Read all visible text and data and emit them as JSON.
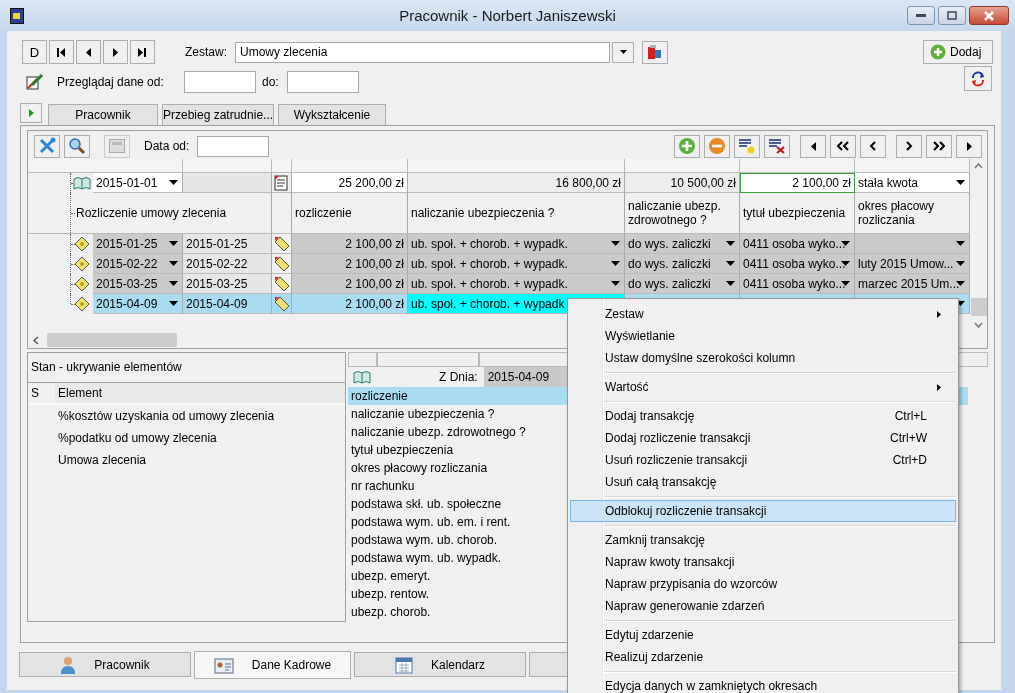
{
  "window": {
    "title": "Pracownik - Norbert Janiszewski"
  },
  "nav_first_label": "D",
  "zestaw": {
    "label": "Zestaw:",
    "value": "Umowy zlecenia"
  },
  "add_button": "Dodaj",
  "browse": {
    "label": "Przeglądaj dane od:",
    "to_label": "do:"
  },
  "tabs": [
    {
      "label": "Pracownik",
      "selected": false
    },
    {
      "label": "Przebieg zatrudnie...",
      "selected": false
    },
    {
      "label": "Wykształcenie",
      "selected": false
    }
  ],
  "grid": {
    "date_label": "Data od:",
    "summary": {
      "date": "2015-01-01",
      "amount": "25 200,00 zł",
      "amount_2": "16 800,00 zł",
      "amount_3": "10 500,00 zł",
      "amount_4": "2 100,00 zł",
      "mode": "stała kwota"
    },
    "group_label": "Rozliczenie umowy zlecenia",
    "columns": [
      "rozliczenie",
      "naliczanie ubezpieczenia ?",
      "naliczanie ubezp. zdrowotnego ?",
      "tytuł ubezpieczenia",
      "okres płacowy rozliczania"
    ],
    "rows": [
      {
        "date": "2015-01-25",
        "date_2": "2015-01-25",
        "amount": "2 100,00 zł",
        "insurance": "ub. społ. + chorob. + wypadk.",
        "health": "do wys. zaliczki",
        "title": "0411 osoba wyko...",
        "selected": false
      },
      {
        "date": "2015-02-22",
        "date_2": "2015-02-22",
        "amount": "2 100,00 zł",
        "insurance": "ub. społ. + chorob. + wypadk.",
        "health": "do wys. zaliczki",
        "title": "0411 osoba wyko...",
        "period": "luty 2015 Umow...",
        "selected": false
      },
      {
        "date": "2015-03-25",
        "date_2": "2015-03-25",
        "amount": "2 100,00 zł",
        "insurance": "ub. społ. + chorob. + wypadk.",
        "health": "do wys. zaliczki",
        "title": "0411 osoba wyko...",
        "period": "marzec 2015 Um...",
        "selected": false
      },
      {
        "date": "2015-04-09",
        "date_2": "2015-04-09",
        "amount": "2 100,00 zł",
        "insurance": "ub. społ. + chorob. + wypadk",
        "selected": true
      }
    ]
  },
  "visibility_panel": {
    "title": "Stan - ukrywanie elementów",
    "columns": [
      "S",
      "Element"
    ],
    "items": [
      "%kosztów uzyskania od umowy zlecenia",
      "%podatku od umowy zlecenia",
      "Umowa zlecenia"
    ]
  },
  "details_panel": {
    "date_label": "Z Dnia:",
    "date": "2015-04-09",
    "items": [
      {
        "label": "rozliczenie",
        "selected": true
      },
      {
        "label": "naliczanie ubezpieczenia ?",
        "selected": false
      },
      {
        "label": "naliczanie ubezp. zdrowotnego ?",
        "selected": false
      },
      {
        "label": "tytuł ubezpieczenia",
        "selected": false
      },
      {
        "label": "okres płacowy rozliczania",
        "selected": false
      },
      {
        "label": "nr rachunku",
        "selected": false
      },
      {
        "label": "podstawa skł. ub. społeczne",
        "selected": false
      },
      {
        "label": "podstawa wym. ub. em. i rent.",
        "selected": false
      },
      {
        "label": "podstawa wym. ub. chorob.",
        "selected": false
      },
      {
        "label": "podstawa wym. ub. wypadk.",
        "selected": false
      },
      {
        "label": "ubezp. emeryt.",
        "selected": false
      },
      {
        "label": "ubezp. rentow.",
        "selected": false
      },
      {
        "label": "ubezp. chorob.",
        "selected": false
      }
    ]
  },
  "bottom_tabs": [
    {
      "label": "Pracownik",
      "kind": "person",
      "selected": false
    },
    {
      "label": "Dane Kadrowe",
      "kind": "card",
      "selected": true
    },
    {
      "label": "Kalendarz",
      "kind": "calendar",
      "selected": false
    }
  ],
  "context_menu": [
    {
      "kind": "item",
      "label": "Zestaw",
      "submenu": true,
      "selected": false
    },
    {
      "kind": "item",
      "label": "Wyświetlanie",
      "selected": false
    },
    {
      "kind": "item",
      "label": "Ustaw domyślne szerokości kolumn",
      "selected": false
    },
    {
      "kind": "separator"
    },
    {
      "kind": "item",
      "label": "Wartość",
      "submenu": true,
      "selected": false
    },
    {
      "kind": "separator"
    },
    {
      "kind": "item",
      "label": "Dodaj transakcję",
      "shortcut": "Ctrl+L",
      "selected": false
    },
    {
      "kind": "item",
      "label": "Dodaj rozliczenie transakcji",
      "shortcut": "Ctrl+W",
      "selected": false
    },
    {
      "kind": "item",
      "label": "Usuń rozliczenie transakcji",
      "shortcut": "Ctrl+D",
      "selected": false
    },
    {
      "kind": "item",
      "label": "Usuń całą transakcję",
      "selected": false
    },
    {
      "kind": "separator"
    },
    {
      "kind": "item",
      "label": "Odblokuj rozliczenie transakcji",
      "selected": true
    },
    {
      "kind": "separator"
    },
    {
      "kind": "item",
      "label": "Zamknij transakcję",
      "selected": false
    },
    {
      "kind": "item",
      "label": "Napraw kwoty transakcji",
      "selected": false
    },
    {
      "kind": "item",
      "label": "Napraw przypisania do wzorców",
      "selected": false
    },
    {
      "kind": "item",
      "label": "Napraw generowanie zdarzeń",
      "selected": false
    },
    {
      "kind": "separator"
    },
    {
      "kind": "item",
      "label": "Edytuj zdarzenie",
      "selected": false
    },
    {
      "kind": "item",
      "label": "Realizuj zdarzenie",
      "selected": false
    },
    {
      "kind": "separator"
    },
    {
      "kind": "item",
      "label": "Edycja danych w zamkniętych okresach",
      "selected": false
    }
  ]
}
